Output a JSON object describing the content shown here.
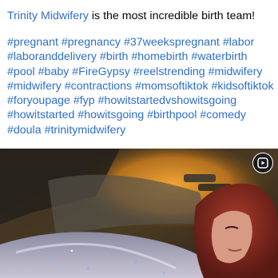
{
  "post": {
    "mention": "Trinity Midwifery",
    "caption_rest": " is the most incredible birth team!",
    "hashtags": [
      "#pregnant",
      "#pregnancy",
      "#37weekspregnant",
      "#labor",
      "#laboranddelivery",
      "#birth",
      "#homebirth",
      "#waterbirth",
      "#pool",
      "#baby",
      "#FireGypsy",
      "#reelstrending",
      "#midwifery",
      "#midwifery",
      "#contractions",
      "#momsoftiktok",
      "#kidsoftiktok",
      "#foryoupage",
      "#fyp",
      "#howitstartedvshowitsgoing",
      "#howitstarted",
      "#howitsgoing",
      "#birthpool",
      "#comedy",
      "#doula",
      "#trinitymidwifery"
    ]
  },
  "media": {
    "type": "video",
    "badge_icon": "reels-icon"
  },
  "colors": {
    "link": "#2d6ec9",
    "text": "#050505",
    "background": "#ffffff"
  }
}
